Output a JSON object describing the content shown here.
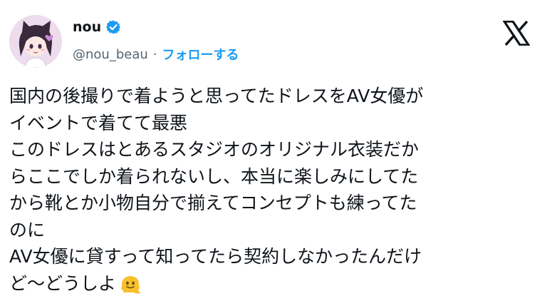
{
  "author": {
    "display_name": "nou",
    "handle": "@nou_beau",
    "separator": "·",
    "follow_label": "フォローする",
    "verified_icon": "verified-badge-icon",
    "avatar_icon": "anime-girl-avatar"
  },
  "platform": {
    "logo": "x-logo-icon"
  },
  "tweet": {
    "text": "国内の後撮りで着ようと思ってたドレスをAV女優が\nイベントで着てて最悪\nこのドレスはとあるスタジオのオリジナル衣装だか\nらここでしか着られないし、本当に楽しみにしてた\nから靴とか小物自分で揃えてコンセプトも練ってた\nのに\nAV女優に貸すって知ってたら契約しなかったんだけ\nど〜どうしよ",
    "trailing_emoji": "melting-face-emoji"
  },
  "colors": {
    "text": "#0f1419",
    "secondary": "#536471",
    "accent": "#1d9bf0"
  }
}
